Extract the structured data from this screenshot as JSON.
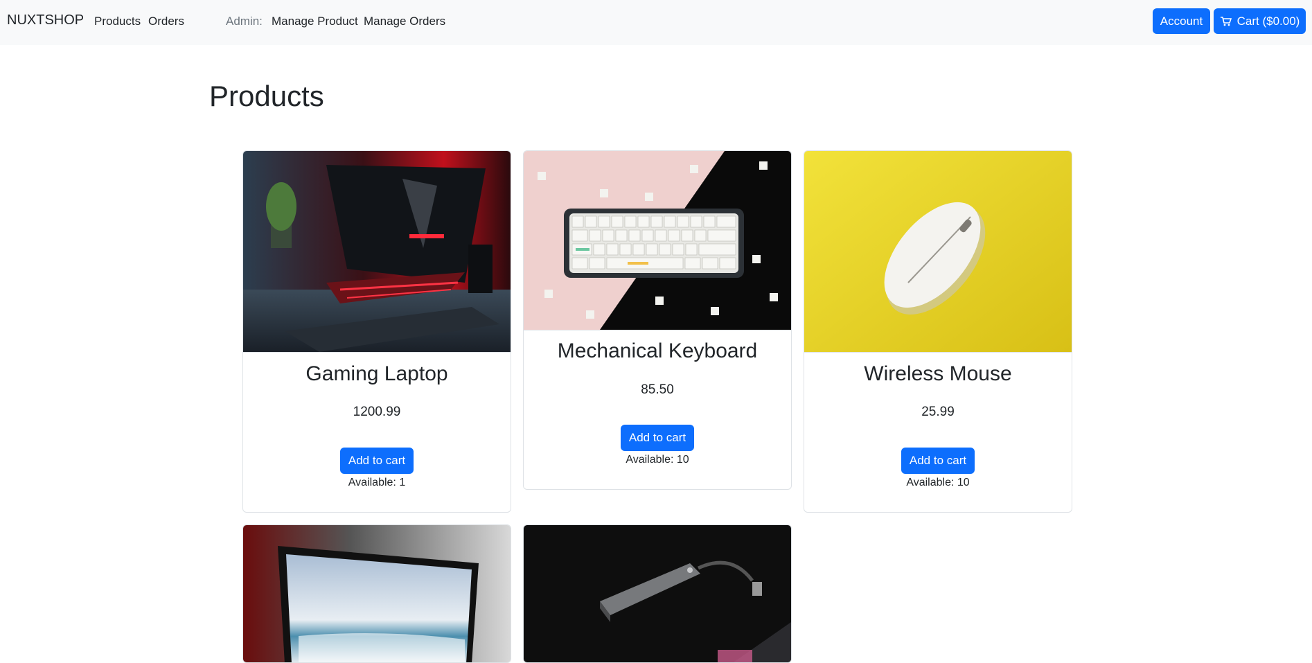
{
  "navbar": {
    "brand": "NUXTSHOP",
    "links": [
      "Products",
      "Orders"
    ],
    "admin_label": "Admin:",
    "admin_links": [
      "Manage Product",
      "Manage Orders"
    ],
    "account_label": "Account",
    "cart_label": "Cart ($0.00)"
  },
  "page": {
    "title": "Products"
  },
  "products": [
    {
      "name": "Gaming Laptop",
      "price": "1200.99",
      "button": "Add to cart",
      "available": "Available: 1"
    },
    {
      "name": "Mechanical Keyboard",
      "price": "85.50",
      "button": "Add to cart",
      "available": "Available: 10"
    },
    {
      "name": "Wireless Mouse",
      "price": "25.99",
      "button": "Add to cart",
      "available": "Available: 10"
    },
    {
      "name": "",
      "price": "",
      "button": "",
      "available": ""
    },
    {
      "name": "",
      "price": "",
      "button": "",
      "available": ""
    }
  ],
  "colors": {
    "primary": "#0d6efd",
    "navbar_bg": "#f8f9fa",
    "border": "#dee2e6",
    "text": "#212529",
    "muted": "#6c757d"
  }
}
